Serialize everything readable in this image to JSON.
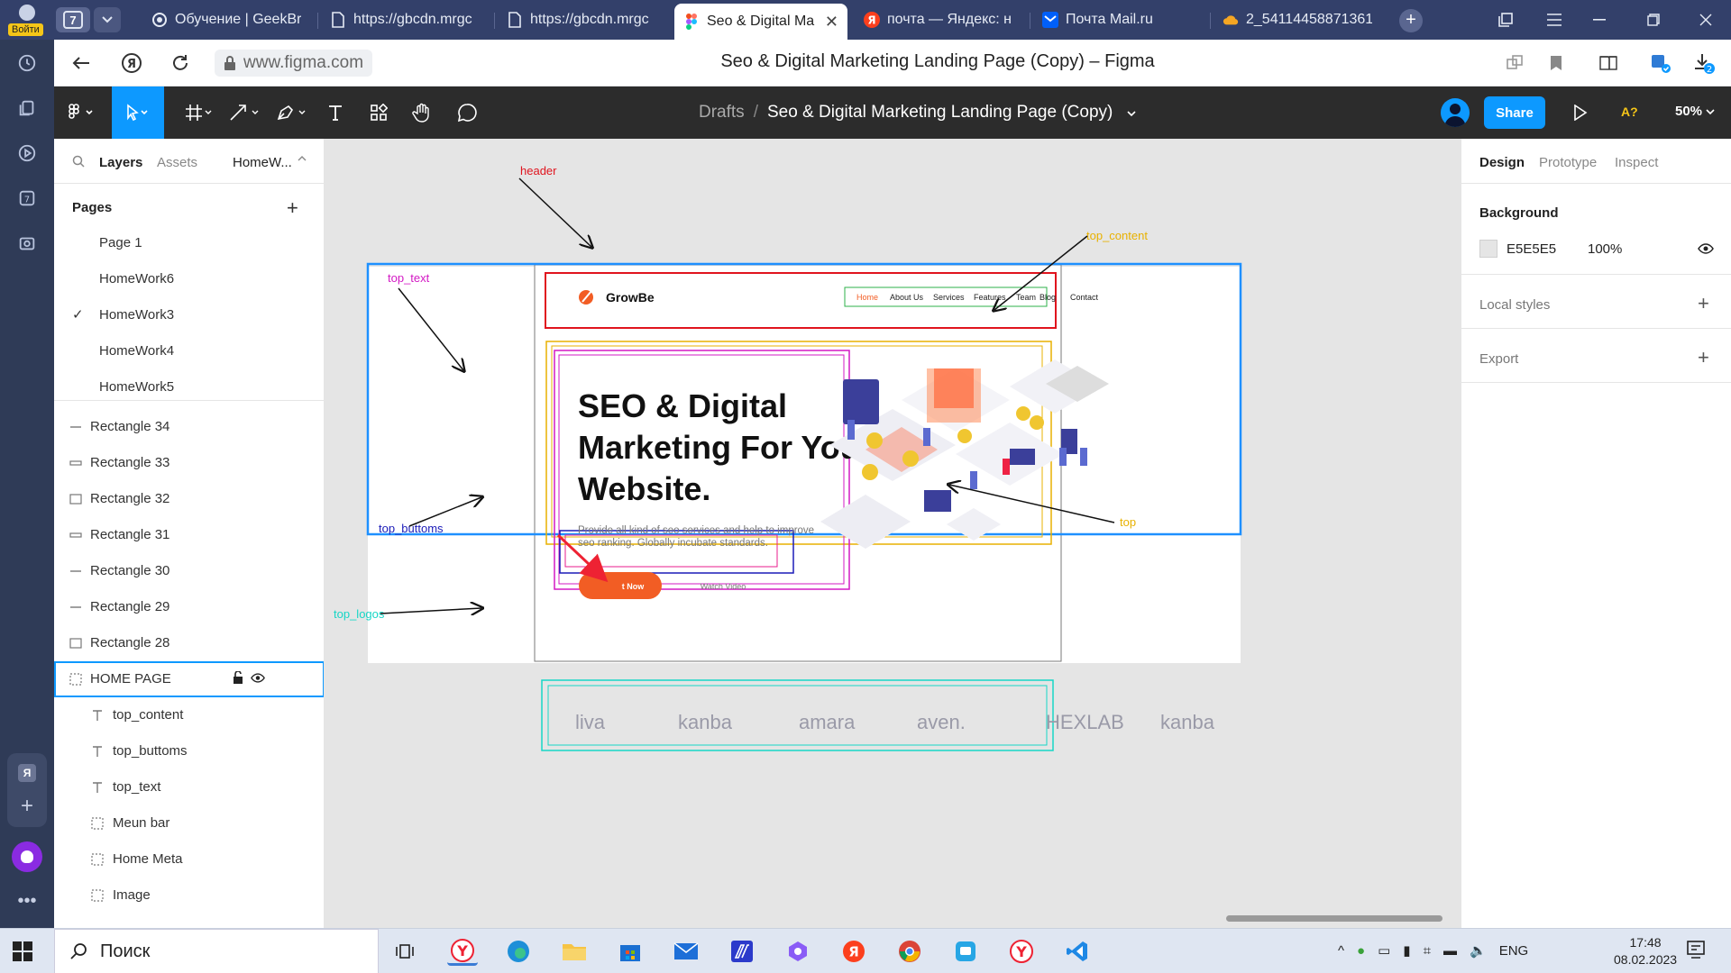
{
  "rail": {
    "login_label": "Войти",
    "counter": "7"
  },
  "browser": {
    "tab_count": "7",
    "tabs": [
      {
        "label": "Обучение | GeekBr",
        "icon": "geekbrains-icon"
      },
      {
        "label": "https://gbcdn.mrgc",
        "icon": "document-icon"
      },
      {
        "label": "https://gbcdn.mrgc",
        "icon": "document-icon"
      },
      {
        "label": "Seo & Digital Ma",
        "icon": "figma-icon",
        "active": true
      },
      {
        "label": "почта — Яндекс: н",
        "icon": "yandex-icon"
      },
      {
        "label": "Почта Mail.ru",
        "icon": "mailru-icon"
      },
      {
        "label": "2_54114458871361",
        "icon": "cloud-icon"
      }
    ],
    "url": "www.figma.com",
    "page_title": "Seo & Digital Marketing Landing Page (Copy) – Figma",
    "downloads_badge": "2"
  },
  "figma": {
    "breadcrumb_folder": "Drafts",
    "separator": "/",
    "file_name": "Seo & Digital Marketing Landing Page (Copy)",
    "share_label": "Share",
    "help_label": "A?",
    "zoom": "50%"
  },
  "left_panel": {
    "tabs": {
      "layers": "Layers",
      "assets": "Assets",
      "page": "HomeW..."
    },
    "pages_title": "Pages",
    "pages": [
      "Page 1",
      "HomeWork6",
      "HomeWork3",
      "HomeWork4",
      "HomeWork5"
    ],
    "current_page": "HomeWork3",
    "layers": [
      {
        "name": "Rectangle 34",
        "icon": "line-icon",
        "indent": 0
      },
      {
        "name": "Rectangle 33",
        "icon": "rect-thin-icon",
        "indent": 0
      },
      {
        "name": "Rectangle 32",
        "icon": "rect-icon",
        "indent": 0
      },
      {
        "name": "Rectangle 31",
        "icon": "rect-thin-icon",
        "indent": 0
      },
      {
        "name": "Rectangle 30",
        "icon": "line-icon",
        "indent": 0
      },
      {
        "name": "Rectangle 29",
        "icon": "line-icon",
        "indent": 0
      },
      {
        "name": "Rectangle 28",
        "icon": "rect-icon",
        "indent": 0
      },
      {
        "name": "HOME PAGE",
        "icon": "frame-icon",
        "indent": 0,
        "selected": true
      },
      {
        "name": "top_content",
        "icon": "text-icon",
        "indent": 1
      },
      {
        "name": "top_buttoms",
        "icon": "text-icon",
        "indent": 1
      },
      {
        "name": "top_text",
        "icon": "text-icon",
        "indent": 1
      },
      {
        "name": "Meun bar",
        "icon": "frame-icon",
        "indent": 1
      },
      {
        "name": "Home Meta",
        "icon": "frame-icon",
        "indent": 1
      },
      {
        "name": "Image",
        "icon": "frame-icon",
        "indent": 1
      }
    ]
  },
  "right_panel": {
    "tabs": {
      "design": "Design",
      "prototype": "Prototype",
      "inspect": "Inspect"
    },
    "background_title": "Background",
    "bg_hex": "E5E5E5",
    "bg_opacity": "100%",
    "local_styles": "Local styles",
    "export": "Export"
  },
  "design": {
    "logo": "GrowBe",
    "nav": [
      "Home",
      "About Us",
      "Services",
      "Features",
      "Team",
      "Blog",
      "Contact"
    ],
    "headline": [
      "SEO & Digital",
      "Marketing For Your",
      "Website."
    ],
    "subtext": [
      "Provide all kind of seo services and help to improve",
      "seo ranking. Globally incubate standards."
    ],
    "primary_btn": "Get Now",
    "primary_btn_visible": "t Now",
    "secondary_btn": "Watch Video",
    "logos": [
      "liva",
      "kanba",
      "amara",
      "aven.",
      "HEXLAB",
      "kanba"
    ],
    "annotations": {
      "header": "header",
      "top_content": "top_content",
      "top_text": "top_text",
      "top_buttoms": "top_buttoms",
      "top": "top",
      "top_logos": "top_logos"
    },
    "colors": {
      "header": "#e0141e",
      "top_content": "#e8b100",
      "top_text": "#d319c4",
      "top_buttoms": "#1b1bb8",
      "top": "#1e90ff",
      "top_logos": "#16d6c6",
      "accent": "#f25d24"
    }
  },
  "taskbar": {
    "search": "Поиск",
    "lang": "ENG",
    "time": "17:48",
    "date": "08.02.2023"
  }
}
